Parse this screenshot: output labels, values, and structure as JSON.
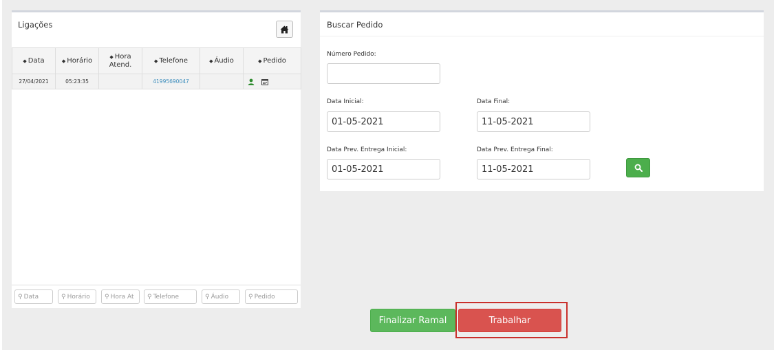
{
  "calls": {
    "title": "Ligações",
    "columns": [
      "Data",
      "Horário",
      "Hora Atend.",
      "Telefone",
      "Áudio",
      "Pedido"
    ],
    "rows": [
      {
        "data": "27/04/2021",
        "horario": "05:23:35",
        "hora_atend": "",
        "telefone": "41995690047",
        "audio": ""
      }
    ],
    "filters": [
      "Data",
      "Horário",
      "Hora At",
      "Telefone",
      "Áudio",
      "Pedido"
    ]
  },
  "search": {
    "title": "Buscar Pedido",
    "numero_label": "Número Pedido:",
    "numero_value": "",
    "data_inicial_label": "Data Inicial:",
    "data_inicial_value": "01-05-2021",
    "data_final_label": "Data Final:",
    "data_final_value": "11-05-2021",
    "prev_inicial_label": "Data Prev. Entrega Inicial:",
    "prev_inicial_value": "01-05-2021",
    "prev_final_label": "Data Prev. Entrega Final:",
    "prev_final_value": "11-05-2021"
  },
  "actions": {
    "finalizar": "Finalizar Ramal",
    "trabalhar": "Trabalhar"
  },
  "colors": {
    "success": "#5cb85c",
    "danger": "#d9534f",
    "link": "#3c8dbc"
  }
}
